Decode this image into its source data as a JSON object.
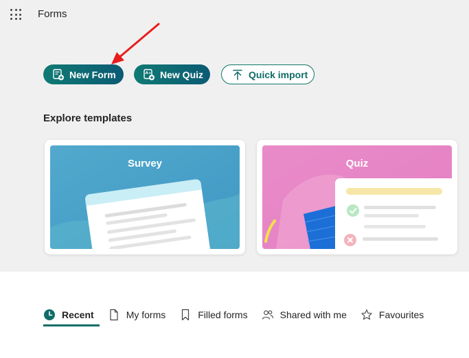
{
  "app": {
    "title": "Forms",
    "launcher_icon": "app-launcher-icon"
  },
  "actions": {
    "new_form": {
      "label": "New Form",
      "icon": "new-form-icon"
    },
    "new_quiz": {
      "label": "New Quiz",
      "icon": "new-quiz-icon"
    },
    "quick_import": {
      "label": "Quick import",
      "icon": "upload-arrow-icon"
    }
  },
  "templates": {
    "heading": "Explore templates",
    "items": [
      {
        "label": "Survey"
      },
      {
        "label": "Quiz"
      }
    ]
  },
  "tabs": [
    {
      "label": "Recent",
      "icon": "clock-icon",
      "active": true
    },
    {
      "label": "My forms",
      "icon": "document-icon"
    },
    {
      "label": "Filled forms",
      "icon": "bookmark-icon"
    },
    {
      "label": "Shared with me",
      "icon": "people-icon"
    },
    {
      "label": "Favourites",
      "icon": "star-icon"
    }
  ],
  "colors": {
    "accent": "#0f6d66",
    "annotation_arrow": "#e81c1c"
  }
}
